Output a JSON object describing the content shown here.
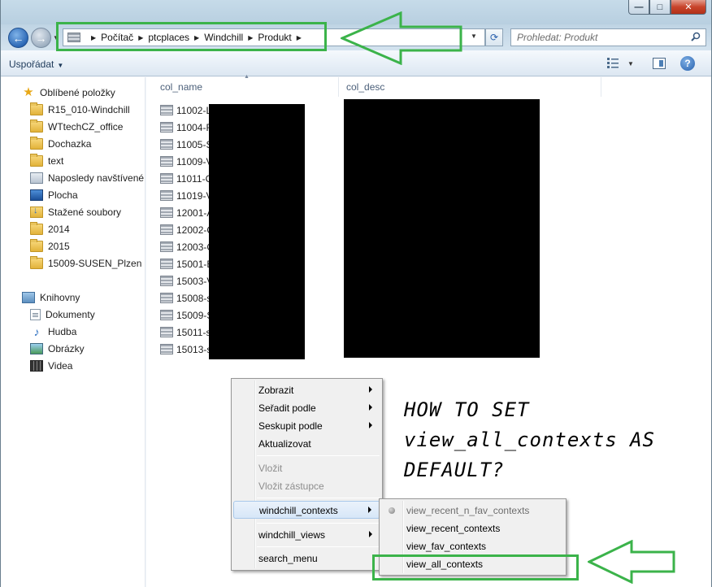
{
  "window": {
    "minimize_label": "—",
    "maximize_label": "□",
    "close_label": "✕"
  },
  "nav": {
    "back_icon": "←",
    "forward_icon": "→"
  },
  "address": {
    "crumbs": [
      "Počítač",
      "ptcplaces",
      "Windchill",
      "Produkt"
    ]
  },
  "search": {
    "placeholder": "Prohledat: Produkt"
  },
  "toolbar": {
    "organize_label": "Uspořádat",
    "help_label": "?"
  },
  "sidebar": {
    "favorites_label": "Oblíbené položky",
    "favorites": [
      {
        "label": "R15_010-Windchill",
        "icon": "folder-icon"
      },
      {
        "label": "WTtechCZ_office",
        "icon": "folder-icon"
      },
      {
        "label": "Dochazka",
        "icon": "folder-icon"
      },
      {
        "label": "text",
        "icon": "folder-icon"
      },
      {
        "label": "Naposledy navštívené",
        "icon": "recent-places-icon"
      },
      {
        "label": "Plocha",
        "icon": "desktop-icon"
      },
      {
        "label": "Stažené soubory",
        "icon": "downloads-icon"
      },
      {
        "label": "2014",
        "icon": "folder-icon"
      },
      {
        "label": "2015",
        "icon": "folder-icon"
      },
      {
        "label": "15009-SUSEN_Plzen",
        "icon": "folder-icon"
      }
    ],
    "libraries_label": "Knihovny",
    "libraries": [
      {
        "label": "Dokumenty",
        "icon": "documents-icon"
      },
      {
        "label": "Hudba",
        "icon": "music-icon"
      },
      {
        "label": "Obrázky",
        "icon": "pictures-icon"
      },
      {
        "label": "Videa",
        "icon": "videos-icon"
      }
    ]
  },
  "table": {
    "columns": [
      "col_name",
      "col_desc"
    ],
    "rows": [
      "11002-L",
      "11004-R",
      "11005-S",
      "11009-V",
      "11011-C",
      "11019-V",
      "12001-A",
      "12002-C",
      "12003-C",
      "15001-E",
      "15003-V",
      "15008-s",
      "15009-S",
      "15011-s",
      "15013-s"
    ]
  },
  "context_menu": {
    "items": {
      "view": "Zobrazit",
      "sort_by": "Seřadit podle",
      "group_by": "Seskupit podle",
      "refresh": "Aktualizovat",
      "paste": "Vložit",
      "paste_shortcut": "Vložit zástupce",
      "windchill_contexts": "windchill_contexts",
      "windchill_views": "windchill_views",
      "search_menu": "search_menu"
    }
  },
  "submenu": {
    "items": [
      "view_recent_n_fav_contexts",
      "view_recent_contexts",
      "view_fav_contexts",
      "view_all_contexts"
    ]
  },
  "annotation": {
    "lines": [
      "HOW TO SET",
      "view_all_contexts AS",
      "DEFAULT?"
    ],
    "color": "#3bb34a"
  }
}
